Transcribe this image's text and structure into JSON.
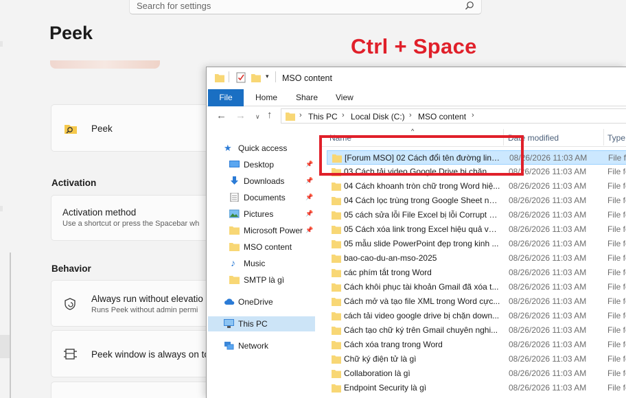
{
  "settings": {
    "search_placeholder": "Search for settings",
    "page_title": "Peek",
    "peek_card_title": "Peek",
    "sections": {
      "activation": "Activation",
      "behavior": "Behavior"
    },
    "activation_method": {
      "title": "Activation method",
      "subtitle": "Use a shortcut or press the Spacebar wh"
    },
    "always_run": {
      "title": "Always run without elevatio",
      "subtitle": "Runs Peek without admin permi"
    },
    "window_top": {
      "title": "Peek window is always on to"
    }
  },
  "overlay": {
    "shortcut_label": "Ctrl + Space"
  },
  "explorer": {
    "window_title": "MSO content",
    "ribbon_tabs": [
      "File",
      "Home",
      "Share",
      "View"
    ],
    "breadcrumb": [
      "This PC",
      "Local Disk (C:)",
      "MSO content"
    ],
    "nav": {
      "quick_access": "Quick access",
      "pinned": [
        "Desktop",
        "Downloads",
        "Documents",
        "Pictures",
        "Microsoft Power"
      ],
      "recent": [
        "MSO content",
        "Music",
        "SMTP là gì"
      ],
      "onedrive": "OneDrive",
      "this_pc": "This PC",
      "network": "Network"
    },
    "columns": {
      "name": "Name",
      "date": "Date modified",
      "type": "Type"
    },
    "files": [
      {
        "name": "[Forum MSO] 02 Cách đổi tên đường link...",
        "date": "08/26/2026 11:03 AM",
        "type": "File fo"
      },
      {
        "name": "03 Cách tải video Google Drive bị chặn D...",
        "date": "08/26/2026 11:03 AM",
        "type": "File fo"
      },
      {
        "name": "04 Cách khoanh tròn chữ trong Word hiệ...",
        "date": "08/26/2026 11:03 AM",
        "type": "File fo"
      },
      {
        "name": "04 Cách lọc trùng trong Google Sheet nh...",
        "date": "08/26/2026 11:03 AM",
        "type": "File fo"
      },
      {
        "name": "05 cách sửa lỗi File Excel bị lỗi Corrupt và...",
        "date": "08/26/2026 11:03 AM",
        "type": "File fo"
      },
      {
        "name": "05 Cách xóa link trong Excel hiệu quả và ...",
        "date": "08/26/2026 11:03 AM",
        "type": "File fo"
      },
      {
        "name": "05 mẫu slide PowerPoint đẹp trong kinh ...",
        "date": "08/26/2026 11:03 AM",
        "type": "File fo"
      },
      {
        "name": "bao-cao-du-an-mso-2025",
        "date": "08/26/2026 11:03 AM",
        "type": "File fo"
      },
      {
        "name": "các phím tắt trong Word",
        "date": "08/26/2026 11:03 AM",
        "type": "File fo"
      },
      {
        "name": "Cách khôi phục tài khoản Gmail đã xóa t...",
        "date": "08/26/2026 11:03 AM",
        "type": "File fo"
      },
      {
        "name": "Cách mở và tạo file XML trong Word cực...",
        "date": "08/26/2026 11:03 AM",
        "type": "File fo"
      },
      {
        "name": "cách tải video google drive bị chặn down...",
        "date": "08/26/2026 11:03 AM",
        "type": "File fo"
      },
      {
        "name": "Cách tạo chữ ký trên Gmail chuyên nghi...",
        "date": "08/26/2026 11:03 AM",
        "type": "File fo"
      },
      {
        "name": "Cách xóa trang trong Word",
        "date": "08/26/2026 11:03 AM",
        "type": "File fo"
      },
      {
        "name": "Chữ ký điện tử là gì",
        "date": "08/26/2026 11:03 AM",
        "type": "File fo"
      },
      {
        "name": "Collaboration là gì",
        "date": "08/26/2026 11:03 AM",
        "type": "File fo"
      },
      {
        "name": "Endpoint Security là gì",
        "date": "08/26/2026 11:03 AM",
        "type": "File fo"
      }
    ]
  },
  "colors": {
    "highlight_red": "#e0202a",
    "file_tab_blue": "#1a6fc3",
    "selection_blue": "#cce8ff",
    "folder_yellow": "#f8d775"
  }
}
